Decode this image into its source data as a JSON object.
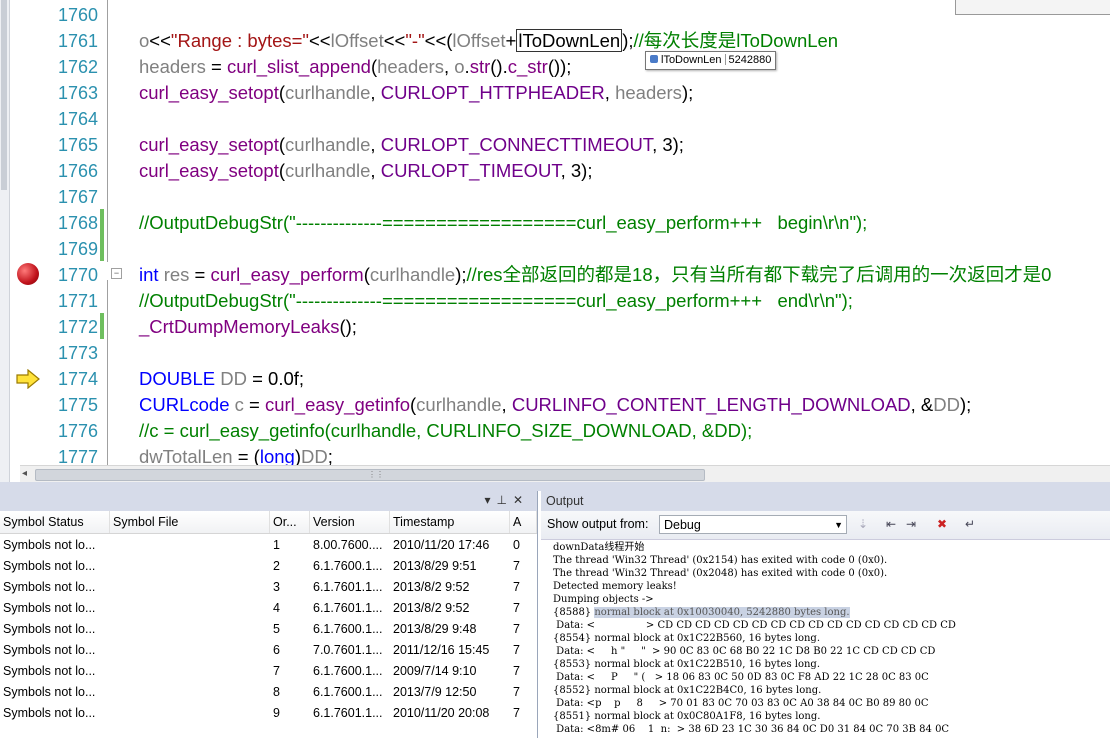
{
  "editor": {
    "lines": [
      {
        "n": "1760",
        "segs": []
      },
      {
        "n": "1761",
        "segs": [
          [
            "gray",
            "o"
          ],
          [
            "",
            "<<"
          ],
          [
            "str",
            "\"Range : bytes=\""
          ],
          [
            "",
            "<<"
          ],
          [
            "gray",
            "lOffset"
          ],
          [
            "",
            "<<"
          ],
          [
            "str",
            "\"-\""
          ],
          [
            "",
            "<<("
          ],
          [
            "gray",
            "lOffset"
          ],
          [
            "",
            "+"
          ],
          [
            "",
            "lToDownLen"
          ],
          [
            "",
            ");"
          ],
          [
            "cmt",
            "//每次长度是lToDownLen"
          ]
        ]
      },
      {
        "n": "1762",
        "segs": [
          [
            "gray",
            "headers"
          ],
          [
            "",
            " = "
          ],
          [
            "fn",
            "curl_slist_append"
          ],
          [
            "",
            "("
          ],
          [
            "gray",
            "headers"
          ],
          [
            "",
            ", "
          ],
          [
            "gray",
            "o"
          ],
          [
            "",
            "."
          ],
          [
            "fn",
            "str"
          ],
          [
            "",
            "()."
          ],
          [
            "fn",
            "c_str"
          ],
          [
            "",
            "());"
          ]
        ]
      },
      {
        "n": "1763",
        "segs": [
          [
            "fn",
            "curl_easy_setopt"
          ],
          [
            "",
            "("
          ],
          [
            "gray",
            "curlhandle"
          ],
          [
            "",
            ", "
          ],
          [
            "mac",
            "CURLOPT_HTTPHEADER"
          ],
          [
            "",
            ", "
          ],
          [
            "gray",
            "headers"
          ],
          [
            "",
            ");"
          ]
        ]
      },
      {
        "n": "1764",
        "segs": []
      },
      {
        "n": "1765",
        "segs": [
          [
            "fn",
            "curl_easy_setopt"
          ],
          [
            "",
            "("
          ],
          [
            "gray",
            "curlhandle"
          ],
          [
            "",
            ", "
          ],
          [
            "mac",
            "CURLOPT_CONNECTTIMEOUT"
          ],
          [
            "",
            ", 3);"
          ]
        ]
      },
      {
        "n": "1766",
        "segs": [
          [
            "fn",
            "curl_easy_setopt"
          ],
          [
            "",
            "("
          ],
          [
            "gray",
            "curlhandle"
          ],
          [
            "",
            ", "
          ],
          [
            "mac",
            "CURLOPT_TIMEOUT"
          ],
          [
            "",
            ", 3);"
          ]
        ]
      },
      {
        "n": "1767",
        "segs": []
      },
      {
        "n": "1768",
        "segs": [
          [
            "cmt",
            "//OutputDebugStr(\"--------------==================curl_easy_perform+++   begin\\r\\n\");"
          ]
        ]
      },
      {
        "n": "1769",
        "segs": []
      },
      {
        "n": "1770",
        "segs": [
          [
            "kw",
            "int"
          ],
          [
            "",
            " "
          ],
          [
            "gray",
            "res"
          ],
          [
            "",
            " = "
          ],
          [
            "fn",
            "curl_easy_perform"
          ],
          [
            "",
            "("
          ],
          [
            "gray",
            "curlhandle"
          ],
          [
            "",
            ");"
          ],
          [
            "cmt",
            "//res全部返回的都是18，只有当所有都下载完了后调用的一次返回才是0"
          ]
        ]
      },
      {
        "n": "1771",
        "segs": [
          [
            "cmt",
            "//OutputDebugStr(\"--------------==================curl_easy_perform+++   end\\r\\n\");"
          ]
        ]
      },
      {
        "n": "1772",
        "segs": [
          [
            "fn",
            "_CrtDumpMemoryLeaks"
          ],
          [
            "",
            "();"
          ]
        ]
      },
      {
        "n": "1773",
        "segs": []
      },
      {
        "n": "1774",
        "segs": [
          [
            "kw",
            "DOUBLE"
          ],
          [
            "",
            " "
          ],
          [
            "gray",
            "DD"
          ],
          [
            "",
            " = 0.0f;"
          ]
        ]
      },
      {
        "n": "1775",
        "segs": [
          [
            "kw",
            "CURLcode"
          ],
          [
            "",
            " "
          ],
          [
            "gray",
            "c"
          ],
          [
            "",
            " = "
          ],
          [
            "fn",
            "curl_easy_getinfo"
          ],
          [
            "",
            "("
          ],
          [
            "gray",
            "curlhandle"
          ],
          [
            "",
            ", "
          ],
          [
            "mac",
            "CURLINFO_CONTENT_LENGTH_DOWNLOAD"
          ],
          [
            "",
            ", &"
          ],
          [
            "gray",
            "DD"
          ],
          [
            "",
            ");"
          ]
        ]
      },
      {
        "n": "1776",
        "segs": [
          [
            "cmt",
            "//c = curl_easy_getinfo(curlhandle, CURLINFO_SIZE_DOWNLOAD, &DD);"
          ]
        ]
      },
      {
        "n": "1777",
        "segs": [
          [
            "gray",
            "dwTotalLen"
          ],
          [
            "",
            " = ("
          ],
          [
            "kw",
            "long"
          ],
          [
            "",
            ")"
          ],
          [
            "gray",
            "DD"
          ],
          [
            "",
            ";"
          ]
        ]
      }
    ],
    "tooltip": {
      "name": "lToDownLen",
      "value": "5242880"
    }
  },
  "modules": {
    "columns": [
      "Symbol Status",
      "Symbol File",
      "Or...",
      "Version",
      "Timestamp",
      "A"
    ],
    "rows": [
      [
        "Symbols not lo...",
        "",
        "1",
        "8.00.7600....",
        "2010/11/20 17:46",
        "0"
      ],
      [
        "Symbols not lo...",
        "",
        "2",
        "6.1.7600.1...",
        "2013/8/29 9:51",
        "7"
      ],
      [
        "Symbols not lo...",
        "",
        "3",
        "6.1.7601.1...",
        "2013/8/2 9:52",
        "7"
      ],
      [
        "Symbols not lo...",
        "",
        "4",
        "6.1.7601.1...",
        "2013/8/2 9:52",
        "7"
      ],
      [
        "Symbols not lo...",
        "",
        "5",
        "6.1.7600.1...",
        "2013/8/29 9:48",
        "7"
      ],
      [
        "Symbols not lo...",
        "",
        "6",
        "7.0.7601.1...",
        "2011/12/16 15:45",
        "7"
      ],
      [
        "Symbols not lo...",
        "",
        "7",
        "6.1.7600.1...",
        "2009/7/14 9:10",
        "7"
      ],
      [
        "Symbols not lo...",
        "",
        "8",
        "6.1.7600.1...",
        "2013/7/9 12:50",
        "7"
      ],
      [
        "Symbols not lo...",
        "",
        "9",
        "6.1.7601.1...",
        "2010/11/20 20:08",
        "7"
      ]
    ]
  },
  "output": {
    "title": "Output",
    "show_from_label": "Show output from:",
    "source": "Debug",
    "lines": [
      "downData线程开始",
      "The thread 'Win32 Thread' (0x2154) has exited with code 0 (0x0).",
      "The thread 'Win32 Thread' (0x2048) has exited with code 0 (0x0).",
      "Detected memory leaks!",
      "Dumping objects ->",
      "{8588} normal block at 0x10030040, 5242880 bytes long.",
      " Data: <                > CD CD CD CD CD CD CD CD CD CD CD CD CD CD CD CD",
      "{8554} normal block at 0x1C22B560, 16 bytes long.",
      " Data: <     h \"     \"  > 90 0C 83 0C 68 B0 22 1C D8 B0 22 1C CD CD CD CD",
      "{8553} normal block at 0x1C22B510, 16 bytes long.",
      " Data: <     P     \" (   > 18 06 83 0C 50 0D 83 0C F8 AD 22 1C 28 0C 83 0C",
      "{8552} normal block at 0x1C22B4C0, 16 bytes long.",
      " Data: <p    p     8     > 70 01 83 0C 70 03 83 0C A0 38 84 0C B0 89 80 0C",
      "{8551} normal block at 0x0C80A1F8, 16 bytes long.",
      " Data: <8m# 06    1  n:  > 38 6D 23 1C 30 36 84 0C D0 31 84 0C 70 3B 84 0C"
    ],
    "highlight_index": 5
  }
}
